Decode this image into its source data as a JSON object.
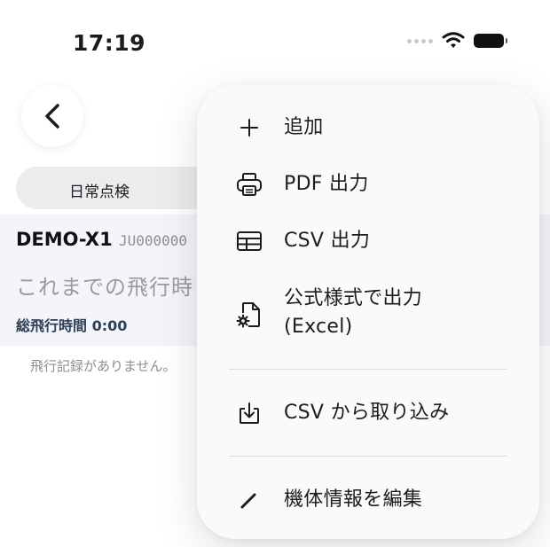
{
  "status_bar": {
    "time": "17:19",
    "icons": [
      "cellular-dots-icon",
      "wifi-icon",
      "battery-icon"
    ]
  },
  "header": {
    "back_icon": "chevron-left-icon"
  },
  "segment": {
    "selected_label": "日常点検"
  },
  "aircraft": {
    "name": "DEMO-X1",
    "registration": "JU000000",
    "summary": "これまでの飛行時",
    "total_flight_time": "総飛行時間 0:00",
    "empty_message": "飛行記録がありません。"
  },
  "menu": {
    "items": [
      {
        "label": "追加",
        "icon": "plus-icon"
      },
      {
        "label": "PDF 出力",
        "icon": "printer-icon"
      },
      {
        "label": "CSV 出力",
        "icon": "table-icon"
      },
      {
        "label_line1": "公式様式で出力",
        "label_line2": "(Excel)",
        "icon": "document-gear-icon"
      },
      {
        "label": "CSV から取り込み",
        "icon": "download-tray-icon"
      },
      {
        "label": "機体情報を編集",
        "icon": "pencil-icon"
      }
    ]
  },
  "colors": {
    "menu_background": "#fafafb",
    "text_primary": "#1c1c1e",
    "text_secondary": "#8e8e93",
    "accent_dark": "#2c3e57"
  }
}
